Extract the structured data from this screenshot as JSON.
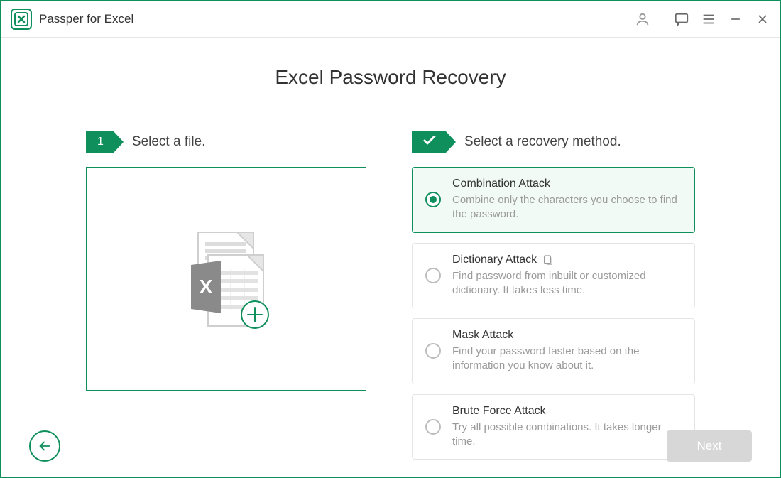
{
  "app": {
    "title": "Passper for Excel"
  },
  "page": {
    "title": "Excel Password Recovery"
  },
  "steps": {
    "step1_number": "1",
    "step1_label": "Select a file.",
    "step2_label": "Select a recovery method."
  },
  "methods": [
    {
      "title": "Combination Attack",
      "desc": "Combine only the characters you choose to find the password.",
      "selected": true,
      "has_info": false
    },
    {
      "title": "Dictionary Attack",
      "desc": "Find password from inbuilt or customized dictionary. It takes less time.",
      "selected": false,
      "has_info": true
    },
    {
      "title": "Mask Attack",
      "desc": "Find your password faster based on the information you know about it.",
      "selected": false,
      "has_info": false
    },
    {
      "title": "Brute Force Attack",
      "desc": "Try all possible combinations. It takes longer time.",
      "selected": false,
      "has_info": false
    }
  ],
  "footer": {
    "next_label": "Next"
  }
}
